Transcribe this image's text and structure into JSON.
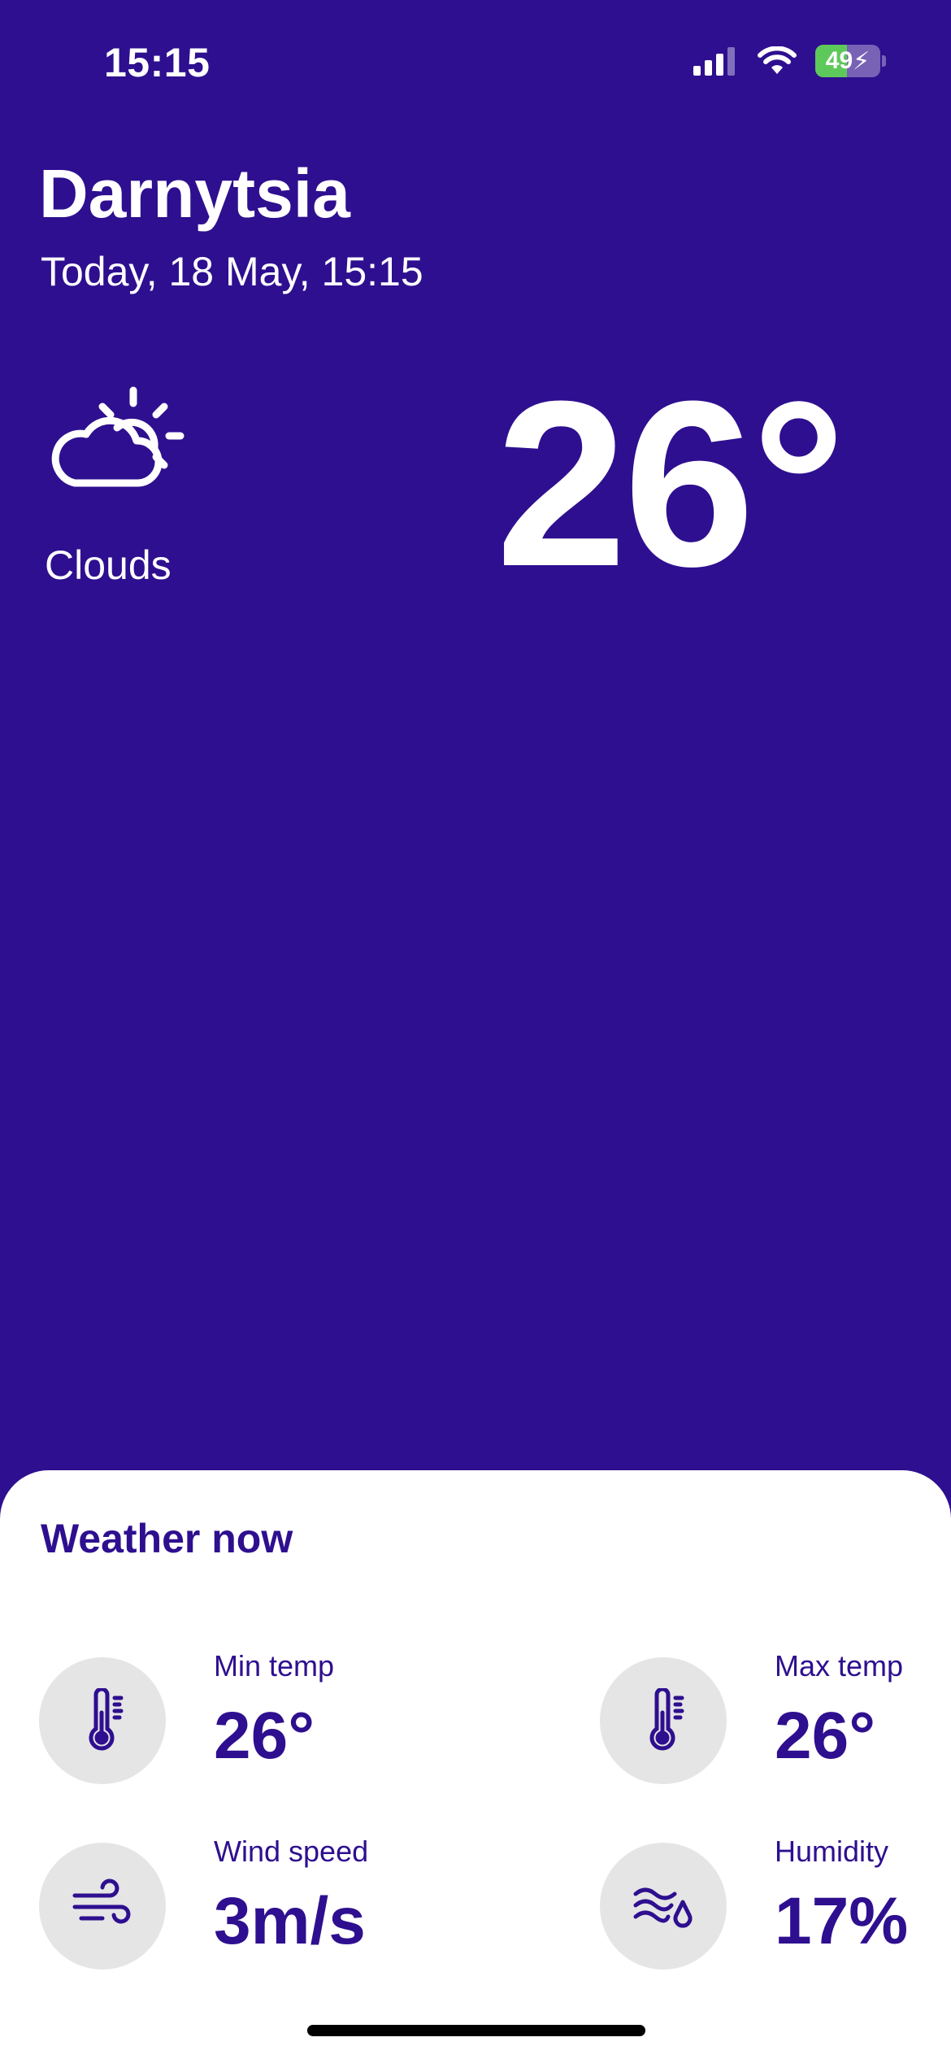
{
  "status_bar": {
    "time": "15:15",
    "battery": "49",
    "battery_level": 0.49,
    "icons": [
      "signal-icon",
      "wifi-icon",
      "battery-icon"
    ]
  },
  "location": {
    "city": "Darnytsia",
    "date": "Today, 18 May, 15:15"
  },
  "current": {
    "condition": "Clouds",
    "condition_icon": "partly-cloudy-icon",
    "temperature": "26°"
  },
  "sheet": {
    "title": "Weather now",
    "stats": [
      {
        "label": "Min temp",
        "value": "26°",
        "icon": "thermometer-icon"
      },
      {
        "label": "Max temp",
        "value": "26°",
        "icon": "thermometer-icon"
      },
      {
        "label": "Wind speed",
        "value": "3m/s",
        "icon": "wind-icon"
      },
      {
        "label": "Humidity",
        "value": "17%",
        "icon": "humidity-icon"
      }
    ]
  },
  "colors": {
    "background": "#2e0f8f",
    "accent": "#2e0f8f",
    "sheet": "#ffffff",
    "icon_circle": "#e5e5e5",
    "battery": "#5ec95b"
  }
}
